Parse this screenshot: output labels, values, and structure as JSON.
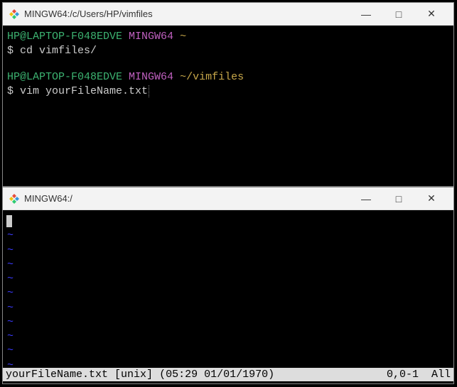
{
  "window1": {
    "title": "MINGW64:/c/Users/HP/vimfiles",
    "prompt1": {
      "user_host": "HP@LAPTOP-F048EDVE",
      "env": "MINGW64",
      "path": "~"
    },
    "cmd1_prompt": "$ ",
    "cmd1": "cd vimfiles/",
    "prompt2": {
      "user_host": "HP@LAPTOP-F048EDVE",
      "env": "MINGW64",
      "path": "~/vimfiles"
    },
    "cmd2_prompt": "$ ",
    "cmd2": "vim yourFileName.txt"
  },
  "window2": {
    "title": "MINGW64:/",
    "tilde": "~",
    "status": {
      "file": "yourFileName.txt",
      "format": "[unix]",
      "time": "(05:29 01/01/1970)",
      "pos": "0,0-1",
      "scroll": "All"
    }
  },
  "controls": {
    "minimize": "—",
    "maximize": "□",
    "close": "✕"
  }
}
